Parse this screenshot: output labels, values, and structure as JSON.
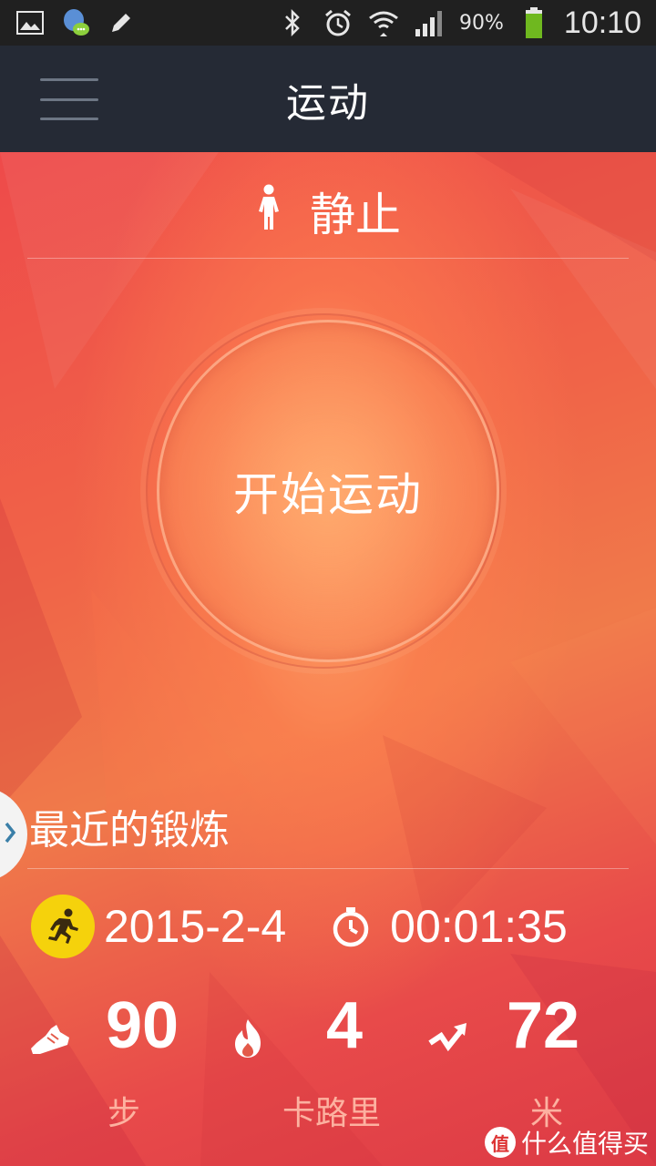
{
  "status_bar": {
    "battery_percent": "90%",
    "time": "10:10",
    "icons": [
      "image-icon",
      "chat-icon",
      "pencil-icon",
      "bluetooth-icon",
      "alarm-icon",
      "wifi-icon",
      "signal-icon",
      "battery-icon"
    ]
  },
  "header": {
    "title": "运动",
    "menu_icon": "hamburger-menu-icon"
  },
  "state": {
    "icon": "person-standing-icon",
    "label": "静止"
  },
  "start_button": {
    "label": "开始运动"
  },
  "recent": {
    "title": "最近的锻炼",
    "date": "2015-2-4",
    "duration": "00:01:35",
    "stats": [
      {
        "icon": "shoe-icon",
        "value": "90",
        "unit": "步"
      },
      {
        "icon": "flame-icon",
        "value": "4",
        "unit": "卡路里"
      },
      {
        "icon": "distance-trend-icon",
        "value": "72",
        "unit": "米"
      }
    ]
  },
  "watermark": {
    "logo": "值",
    "text": "什么值得买"
  },
  "colors": {
    "accent_yellow": "#f5d20c",
    "header_bg": "#252a35",
    "status_bg": "#202020"
  }
}
